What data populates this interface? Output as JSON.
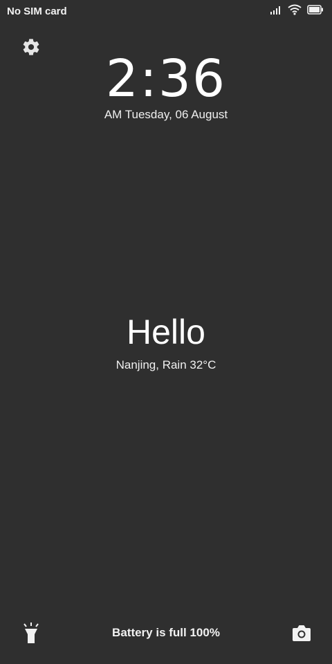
{
  "status_bar": {
    "carrier": "No SIM card",
    "icons": [
      "signal-icon",
      "wifi-icon",
      "battery-icon"
    ]
  },
  "lockscreen": {
    "time": "2:36",
    "date": "AM Tuesday, 06 August",
    "greeting": "Hello",
    "weather": "Nanjing, Rain 32°C",
    "battery_status": "Battery is full 100%"
  },
  "shortcuts": {
    "left": "flashlight-icon",
    "right": "camera-icon",
    "top": "gear-icon"
  },
  "colors": {
    "background": "#2f2f2f",
    "text": "#ffffff"
  }
}
